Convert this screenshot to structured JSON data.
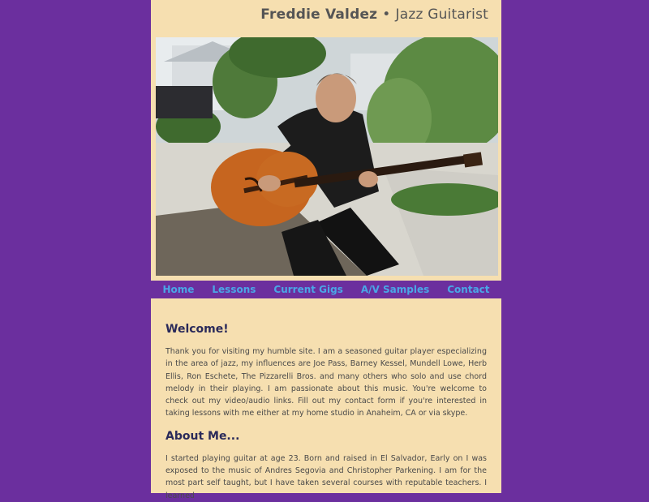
{
  "header": {
    "name": "Freddie Valdez",
    "separator": "•",
    "subtitle": "Jazz Guitarist"
  },
  "photo": {
    "alt": "man playing an orange archtop jazz guitar outdoors",
    "icon": "guitarist-photo"
  },
  "nav": {
    "items": [
      {
        "label": "Home"
      },
      {
        "label": "Lessons"
      },
      {
        "label": "Current Gigs"
      },
      {
        "label": "A/V Samples"
      },
      {
        "label": "Contact"
      }
    ]
  },
  "main": {
    "welcome_heading": "Welcome!",
    "welcome_text": "Thank you for visiting my humble site. I am a seasoned guitar player especializing in the area of jazz, my influences are Joe Pass, Barney Kessel, Mundell Lowe, Herb Ellis, Ron Eschete, The Pizzarelli Bros. and many others who solo and use chord melody in their playing. I am passionate about this music. You're welcome to check out my video/audio links. Fill out my contact form if you're interested in taking lessons with me either at my home studio in Anaheim, CA or via skype.",
    "about_heading": "About Me...",
    "about_text": "I started playing guitar at age 23. Born and raised in El Salvador, Early on I was exposed to the music of Andres Segovia and Christopher Parkening. I am for the most part self taught, but I have taken several courses with reputable teachers. I learned"
  },
  "colors": {
    "background": "#6b2f9e",
    "panel": "#f6dfb0",
    "nav_link": "#4aa6e6",
    "heading": "#2a2a5a"
  }
}
